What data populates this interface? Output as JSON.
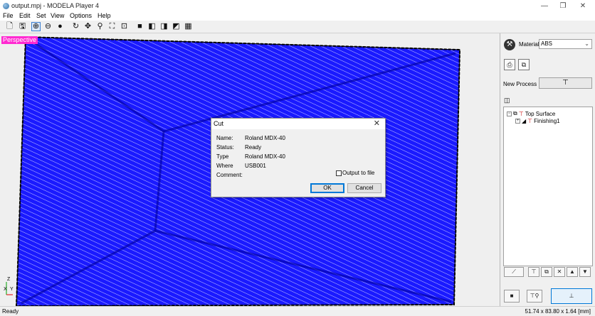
{
  "window": {
    "title": "output.mpj - MODELA Player 4",
    "minimize": "—",
    "restore": "❐",
    "close": "✕"
  },
  "menu": [
    "File",
    "Edit",
    "Set",
    "View",
    "Options",
    "Help"
  ],
  "toolbar": {
    "icons": [
      "new-icon",
      "save-icon",
      "perspective-icon",
      "front-view-icon",
      "sphere-view-icon",
      "rotate-icon",
      "pan-icon",
      "zoom-icon",
      "fit-icon",
      "zoom-area-icon",
      "solid-view-icon",
      "wire-cube-icon",
      "shaded-cube-icon",
      "iso-cube-icon",
      "grid-view-icon"
    ]
  },
  "viewport": {
    "mode_label": "Perspective",
    "model_color": "#1a1aff",
    "axis_labels": {
      "z": "Z",
      "x": "X",
      "y": "Y"
    }
  },
  "dialog": {
    "title": "Cut",
    "close": "✕",
    "fields": [
      {
        "label": "Name:",
        "value": "Roland MDX-40"
      },
      {
        "label": "Status:",
        "value": "Ready"
      },
      {
        "label": "Type",
        "value": "Roland MDX-40"
      },
      {
        "label": "Where",
        "value": "USB001"
      },
      {
        "label": "Comment:",
        "value": ""
      }
    ],
    "checkbox_label": "Output to file",
    "checkbox_checked": false,
    "ok": "OK",
    "cancel": "Cancel"
  },
  "right_panel": {
    "material_label": "Material",
    "material_value": "ABS",
    "new_process_label": "New Process",
    "tree": {
      "root": "Top Surface",
      "child": "Finishing1"
    }
  },
  "status": {
    "left": "Ready",
    "right": "51.74 x 83.80 x 1.64 [mm]"
  }
}
